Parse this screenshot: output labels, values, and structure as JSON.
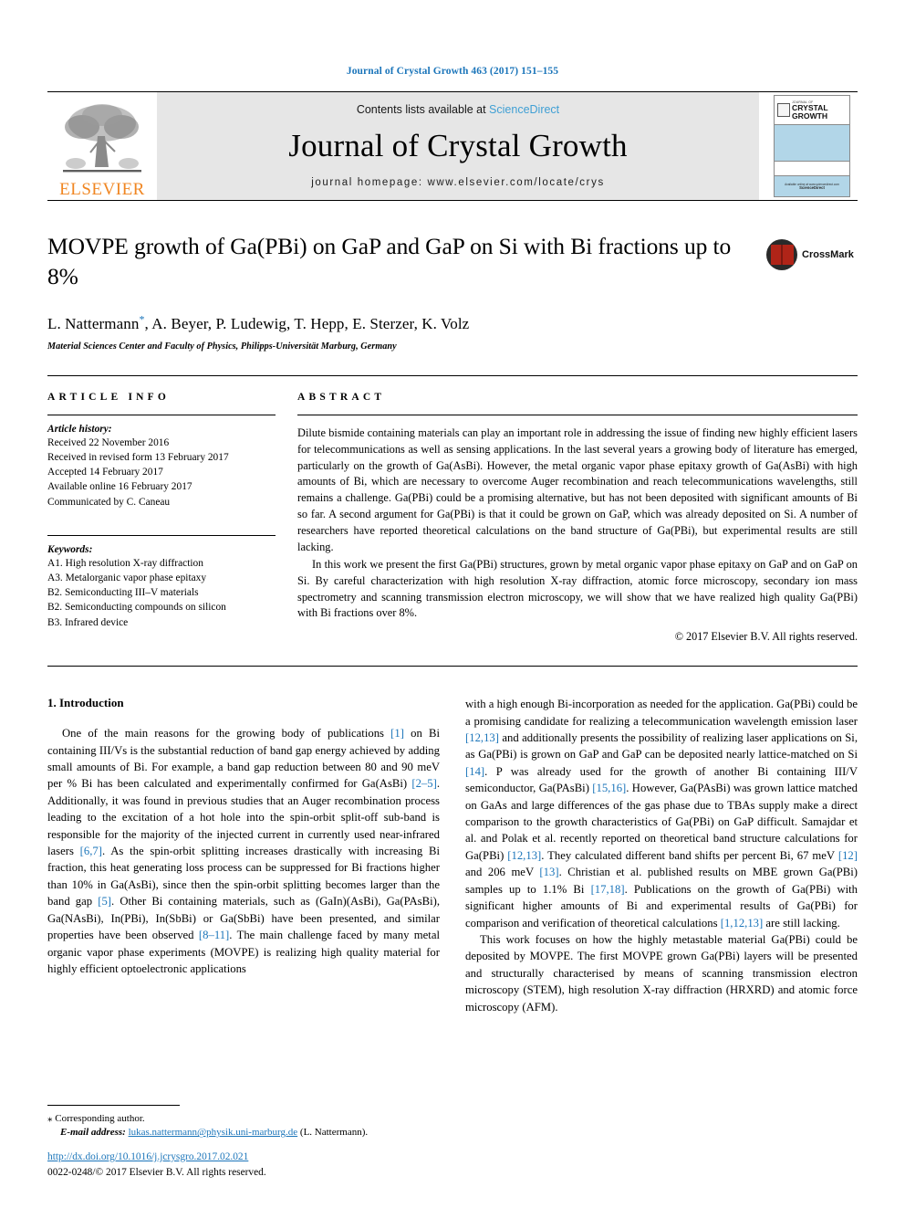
{
  "running_head": "Journal of Crystal Growth 463 (2017) 151–155",
  "masthead": {
    "publisher_name": "ELSEVIER",
    "contents_prefix": "Contents lists available at ",
    "contents_link": "ScienceDirect",
    "journal_title": "Journal of Crystal Growth",
    "homepage": "journal homepage: www.elsevier.com/locate/crys",
    "cover": {
      "small_label": "JOURNAL OF",
      "title_line1": "CRYSTAL",
      "title_line2": "GROWTH",
      "foot_line1": "Available online at www.sciencedirect.com",
      "foot_line2": "ScienceDirect"
    }
  },
  "article": {
    "title": "MOVPE growth of Ga(PBi) on GaP and GaP on Si with Bi fractions up to 8%",
    "authors": "L. Nattermann, A. Beyer, P. Ludewig, T. Hepp, E. Sterzer, K. Volz",
    "author_marker": "*",
    "affiliation": "Material Sciences Center and Faculty of Physics, Philipps-Universität Marburg, Germany",
    "crossmark_label": "CrossMark"
  },
  "article_info": {
    "heading": "ARTICLE INFO",
    "history_label": "Article history:",
    "history": [
      "Received 22 November 2016",
      "Received in revised form 13 February 2017",
      "Accepted 14 February 2017",
      "Available online 16 February 2017",
      "Communicated by C. Caneau"
    ],
    "keywords_label": "Keywords:",
    "keywords": [
      "A1. High resolution X-ray diffraction",
      "A3. Metalorganic vapor phase epitaxy",
      "B2. Semiconducting III–V materials",
      "B2. Semiconducting compounds on silicon",
      "B3. Infrared device"
    ]
  },
  "abstract": {
    "heading": "ABSTRACT",
    "paragraph1": "Dilute bismide containing materials can play an important role in addressing the issue of finding new highly efficient lasers for telecommunications as well as sensing applications. In the last several years a growing body of literature has emerged, particularly on the growth of Ga(AsBi). However, the metal organic vapor phase epitaxy growth of Ga(AsBi) with high amounts of Bi, which are necessary to overcome Auger recombination and reach telecommunications wavelengths, still remains a challenge. Ga(PBi) could be a promising alternative, but has not been deposited with significant amounts of Bi so far. A second argument for Ga(PBi) is that it could be grown on GaP, which was already deposited on Si. A number of researchers have reported theoretical calculations on the band structure of Ga(PBi), but experimental results are still lacking.",
    "paragraph2": "In this work we present the first Ga(PBi) structures, grown by metal organic vapor phase epitaxy on GaP and on GaP on Si. By careful characterization with high resolution X-ray diffraction, atomic force microscopy, secondary ion mass spectrometry and scanning transmission electron microscopy, we will show that we have realized high quality Ga(PBi) with Bi fractions over 8%.",
    "copyright": "© 2017 Elsevier B.V. All rights reserved."
  },
  "body": {
    "section_heading": "1. Introduction",
    "left_paragraph": "One of the main reasons for the growing body of publications [1] on Bi containing III/Vs is the substantial reduction of band gap energy achieved by adding small amounts of Bi. For example, a band gap reduction between 80 and 90 meV per % Bi has been calculated and experimentally confirmed for Ga(AsBi) [2–5]. Additionally, it was found in previous studies that an Auger recombination process leading to the excitation of a hot hole into the spin-orbit split-off sub-band is responsible for the majority of the injected current in currently used near-infrared lasers [6,7]. As the spin-orbit splitting increases drastically with increasing Bi fraction, this heat generating loss process can be suppressed for Bi fractions higher than 10% in Ga(AsBi), since then the spin-orbit splitting becomes larger than the band gap [5]. Other Bi containing materials, such as (GaIn)(AsBi), Ga(PAsBi), Ga(NAsBi), In(PBi), In(SbBi) or Ga(SbBi) have been presented, and similar properties have been observed [8–11]. The main challenge faced by many metal organic vapor phase experiments (MOVPE) is realizing high quality material for highly efficient optoelectronic applications",
    "right_paragraph1": "with a high enough Bi-incorporation as needed for the application. Ga(PBi) could be a promising candidate for realizing a telecommunication wavelength emission laser [12,13] and additionally presents the possibility of realizing laser applications on Si, as Ga(PBi) is grown on GaP and GaP can be deposited nearly lattice-matched on Si [14]. P was already used for the growth of another Bi containing III/V semiconductor, Ga(PAsBi) [15,16]. However, Ga(PAsBi) was grown lattice matched on GaAs and large differences of the gas phase due to TBAs supply make a direct comparison to the growth characteristics of Ga(PBi) on GaP difficult. Samajdar et al. and Polak et al. recently reported on theoretical band structure calculations for Ga(PBi) [12,13]. They calculated different band shifts per percent Bi, 67 meV [12] and 206 meV [13]. Christian et al. published results on MBE grown Ga(PBi) samples up to 1.1% Bi [17,18]. Publications on the growth of Ga(PBi) with significant higher amounts of Bi and experimental results of Ga(PBi) for comparison and verification of theoretical calculations [1,12,13] are still lacking.",
    "right_paragraph2": "This work focuses on how the highly metastable material Ga(PBi) could be deposited by MOVPE. The first MOVPE grown Ga(PBi) layers will be presented and structurally characterised by means of scanning transmission electron microscopy (STEM), high resolution X-ray diffraction (HRXRD) and atomic force microscopy (AFM)."
  },
  "footnote": {
    "corresponding": "Corresponding author.",
    "email_label": "E-mail address:",
    "email": "lukas.nattermann@physik.uni-marburg.de",
    "email_suffix": "(L. Nattermann)."
  },
  "footer": {
    "doi": "http://dx.doi.org/10.1016/j.jcrysgro.2017.02.021",
    "issn_line": "0022-0248/© 2017 Elsevier B.V. All rights reserved."
  },
  "colors": {
    "link_blue": "#1b75ba",
    "sciencedirect_blue": "#3f9fd4",
    "elsevier_orange": "#f08622",
    "masthead_gray": "#e6e6e6",
    "cover_blue": "#b2d6e8"
  }
}
